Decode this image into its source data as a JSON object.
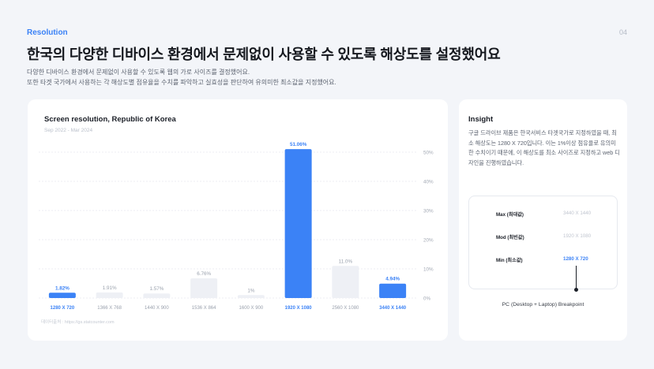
{
  "header": {
    "section_label": "Resolution",
    "page_number": "04",
    "headline": "한국의 다양한 디바이스 환경에서 문제없이 사용할 수 있도록 해상도를 설정했어요",
    "desc_line1": "다양한 디바이스 환경에서 문제없이 사용할 수 있도록 웹의 가로 사이즈를 결정했어요.",
    "desc_line2": "또한 타겟 국가에서 사용하는 각 해상도별 점유율을 수치를 파악하고 실효성을 판단하여 유의미한 최소값을 지정했어요."
  },
  "chart_card": {
    "source": "데이터출처 : https://gs.statcounter.com"
  },
  "chart_data": {
    "type": "bar",
    "title": "Screen resolution, Republic of Korea",
    "subtitle": "Sep 2022 - Mar 2024",
    "categories": [
      "1280 X 720",
      "1366 X 768",
      "1440 X 900",
      "1536 X 864",
      "1600 X 900",
      "1920 X 1080",
      "2560 X 1080",
      "3440 X 1440"
    ],
    "values": [
      1.82,
      1.91,
      1.57,
      6.76,
      1,
      51.06,
      11.0,
      4.94
    ],
    "value_labels": [
      "1.82%",
      "1.91%",
      "1.57%",
      "6.76%",
      "1%",
      "51.06%",
      "11.0%",
      "4.94%"
    ],
    "highlighted": [
      true,
      false,
      false,
      false,
      false,
      true,
      false,
      true
    ],
    "y_ticks": [
      "0%",
      "10%",
      "20%",
      "30%",
      "40%",
      "50%"
    ],
    "ylim": [
      0,
      50
    ],
    "grid": true,
    "colors": {
      "highlight": "#3b82f6",
      "muted": "#eef0f5",
      "label_muted": "#9aa1ad"
    }
  },
  "insight": {
    "title": "Insight",
    "text": "구글 드라이브 제품은 한국서비스 타겟국가로 지정하였을 때, 최소 해상도는 1280 X 720입니다. 이는 1%이상 점유율로 유의미한 수치이기 때문에, 이 해상도를 최소 사이즈로 지정하고 web 디자인을 진행하였습니다.",
    "breakpoints": [
      {
        "label": "Max (최대값)",
        "value": "3440 X 1440",
        "active": false
      },
      {
        "label": "Mod (최빈값)",
        "value": "1920 X 1080",
        "active": false
      },
      {
        "label": "Min (최소값)",
        "value": "1280 X 720",
        "active": true
      }
    ],
    "breakpoint_caption": "PC (Desktop + Laptop) Breakpoint"
  }
}
